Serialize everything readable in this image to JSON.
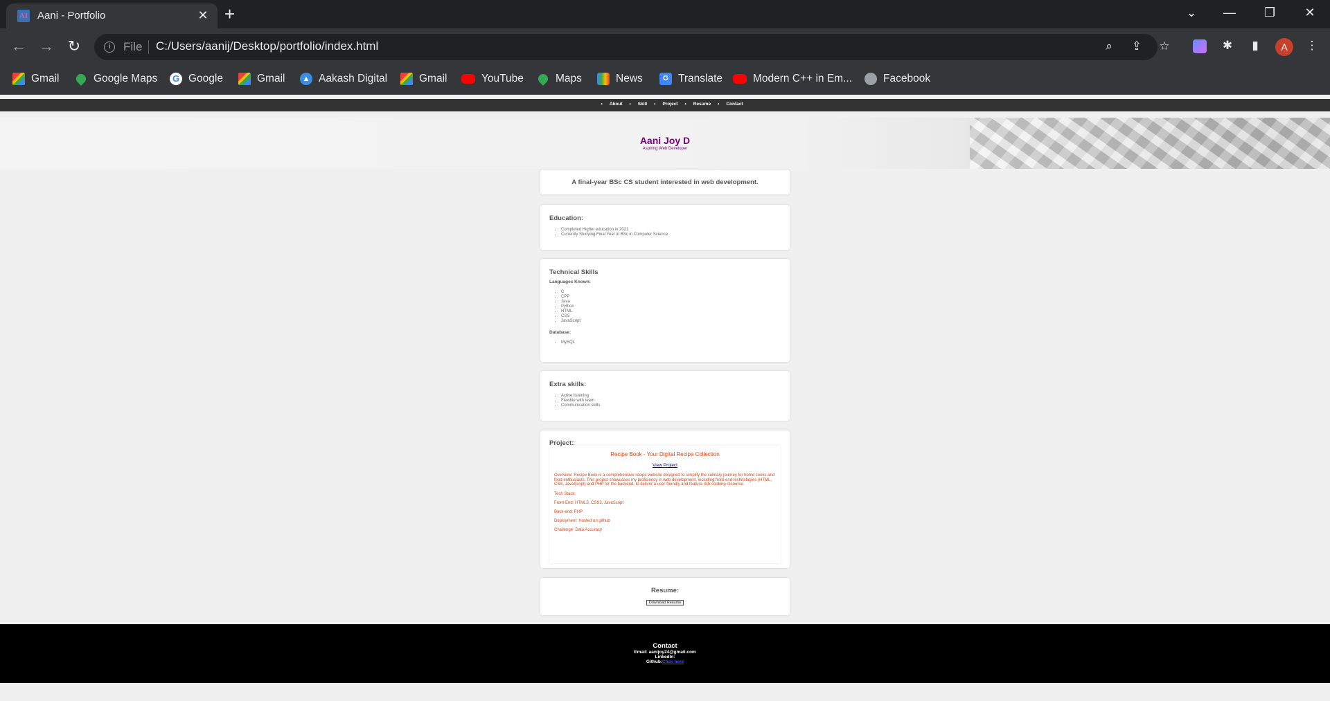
{
  "browser": {
    "tab_title": "Aani - Portfolio",
    "tab_favicon_text": "AI",
    "url_scheme": "File",
    "url": "C:/Users/aanij/Desktop/portfolio/index.html",
    "profile_initial": "A",
    "bookmarks": [
      {
        "label": "Gmail",
        "icon": "gmail-icon"
      },
      {
        "label": "Google Maps",
        "icon": "maps-icon"
      },
      {
        "label": "Google",
        "icon": "google-icon"
      },
      {
        "label": "Gmail",
        "icon": "gmail-icon"
      },
      {
        "label": "Aakash Digital",
        "icon": "aakash-icon"
      },
      {
        "label": "Gmail",
        "icon": "gmail-icon"
      },
      {
        "label": "YouTube",
        "icon": "youtube-icon"
      },
      {
        "label": "Maps",
        "icon": "maps-icon"
      },
      {
        "label": "News",
        "icon": "news-icon"
      },
      {
        "label": "Translate",
        "icon": "translate-icon"
      },
      {
        "label": "Modern C++ in Em...",
        "icon": "youtube-icon"
      },
      {
        "label": "Facebook",
        "icon": "globe-icon"
      }
    ]
  },
  "site": {
    "nav": [
      "About",
      "Skill",
      "Project",
      "Resume",
      "Contact"
    ],
    "name": "Aani Joy D",
    "tagline": "Aspiring Web Developer",
    "intro": "A final-year BSc CS student interested in web development.",
    "education": {
      "title": "Education:",
      "items": [
        "Completed Higher education in 2021",
        "Currently Studying Final Year in BSc in Computer Science"
      ]
    },
    "skills": {
      "title": "Technical Skills",
      "languages_label": "Languages Known:",
      "languages": [
        "C",
        "CPP",
        "Java",
        "Python",
        "HTML",
        "CSS",
        "JavaScript"
      ],
      "database_label": "Database:",
      "databases": [
        "MySQL"
      ]
    },
    "extra": {
      "title": "Extra skills:",
      "items": [
        "Active listening",
        "Flexible with team",
        "Communication skills"
      ]
    },
    "project": {
      "title": "Project:",
      "name": "Recipe Book - Your Digital Recipe Collection",
      "link": "View Project",
      "overview": "Overview: Recipe Book is a comprehensive recipe website designed to simplify the culinary journey for home cooks and food enthusiasts. This project showcases my proficiency in web development, including front-end technologies (HTML, CSS, JavaScript) and PHP for the backend, to deliver a user-friendly and feature-rich cooking resource.",
      "tech_stack": "Tech Stack:",
      "frontend": "Front-End: HTML5, CSS3, JavaScript",
      "backend": "Back-end: PHP",
      "deployment": "Deployment: Hosted on github",
      "challenge": "Challenge: Data Accuracy"
    },
    "resume": {
      "title": "Resume:",
      "button": "Download Resume"
    },
    "contact": {
      "title": "Contact",
      "email": "Email: aanijoy24@gmail.com",
      "linkedin": "LinkedIn:",
      "github_label": "Github:",
      "github_link": "Click here"
    }
  }
}
